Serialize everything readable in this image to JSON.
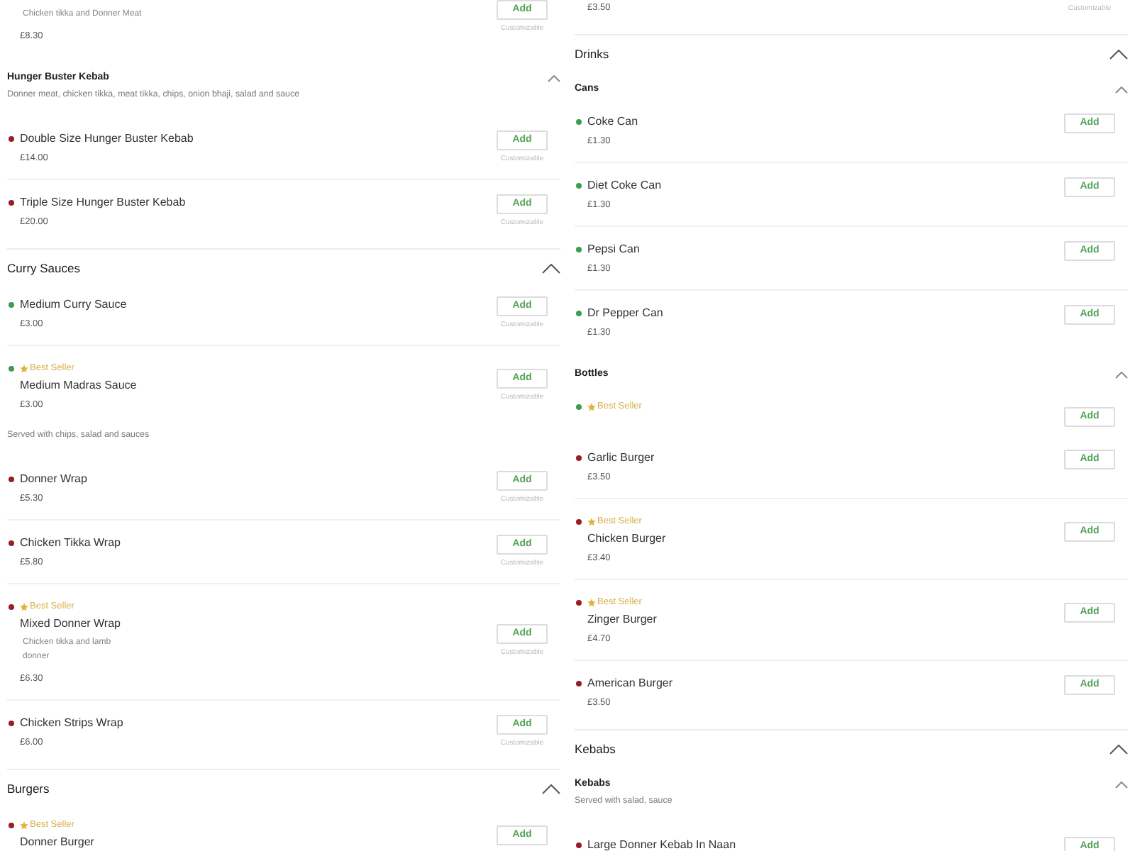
{
  "columns": [
    {
      "groups": [
        {
          "kind": "plain",
          "items": [
            {
              "description": "Chicken tikka and Donner Meat",
              "price": "£8.30",
              "button": "Add",
              "note": "Customizable"
            }
          ]
        },
        {
          "kind": "subsection",
          "title": "Hunger Buster Kebab",
          "description": "Donner meat, chicken tikka, meat tikka, chips, onion bhaji, salad and sauce",
          "expanded": true,
          "items": [
            {
              "color": "#9a1c25",
              "name": "Double Size Hunger Buster Kebab",
              "price": "£14.00",
              "button": "Add",
              "note": "Customizable"
            },
            {
              "color": "#9a1c25",
              "name": "Triple Size Hunger Buster Kebab",
              "price": "£20.00",
              "button": "Add",
              "note": "Customizable"
            }
          ]
        },
        {
          "kind": "section",
          "title": "Curry Sauces",
          "expanded": true,
          "items": [
            {
              "color": "#3e9b4f",
              "name": "Medium Curry Sauce",
              "price": "£3.00",
              "button": "Add",
              "note": "Customizable"
            },
            {
              "color": "#3e9b4f",
              "badge": "Best Seller",
              "name": "Medium Madras Sauce",
              "price": "£3.00",
              "button": "Add",
              "note": "Customizable"
            }
          ]
        },
        {
          "kind": "subsection",
          "description": "Served with chips, salad and sauces",
          "items": [
            {
              "color": "#9a1c25",
              "name": "Donner Wrap",
              "price": "£5.30",
              "button": "Add",
              "note": "Customizable"
            },
            {
              "color": "#9a1c25",
              "name": "Chicken Tikka Wrap",
              "price": "£5.80",
              "button": "Add",
              "note": "Customizable"
            },
            {
              "color": "#9a1c25",
              "badge": "Best Seller",
              "name": "Mixed Donner Wrap",
              "description": "Chicken tikka and lamb\ndonner",
              "price": "£6.30",
              "button": "Add",
              "note": "Customizable"
            },
            {
              "color": "#9a1c25",
              "name": "Chicken Strips Wrap",
              "price": "£6.00",
              "button": "Add",
              "note": "Customizable"
            }
          ]
        },
        {
          "kind": "section",
          "title": "Burgers",
          "expanded": true,
          "items": [
            {
              "color": "#9a1c25",
              "badge": "Best Seller",
              "name": "Donner Burger",
              "button": "Add"
            }
          ]
        }
      ]
    },
    {
      "groups": [
        {
          "kind": "plain",
          "items": [
            {
              "price": "£3.50",
              "note": "Customizable"
            }
          ]
        },
        {
          "kind": "section",
          "title": "Drinks",
          "expanded": true
        },
        {
          "kind": "subsection",
          "title": "Cans",
          "expanded": true,
          "items": [
            {
              "color": "#3e9b4f",
              "name": "Coke Can",
              "price": "£1.30",
              "button": "Add"
            },
            {
              "color": "#3e9b4f",
              "name": "Diet Coke Can",
              "price": "£1.30",
              "button": "Add"
            },
            {
              "color": "#3e9b4f",
              "name": "Pepsi Can",
              "price": "£1.30",
              "button": "Add"
            },
            {
              "color": "#3e9b4f",
              "name": "Dr Pepper Can",
              "price": "£1.30",
              "button": "Add"
            }
          ]
        },
        {
          "kind": "subsection",
          "title": "Bottles",
          "expanded": true,
          "items": [
            {
              "color": "#3e9b4f",
              "badge": "Best Seller",
              "button": "Add"
            }
          ]
        },
        {
          "kind": "plain",
          "items": [
            {
              "color": "#9a1c25",
              "name": "Garlic Burger",
              "price": "£3.50",
              "button": "Add"
            },
            {
              "color": "#9a1c25",
              "badge": "Best Seller",
              "name": "Chicken Burger",
              "price": "£3.40",
              "button": "Add"
            },
            {
              "color": "#9a1c25",
              "badge": "Best Seller",
              "name": "Zinger Burger",
              "price": "£4.70",
              "button": "Add"
            },
            {
              "color": "#9a1c25",
              "name": "American Burger",
              "price": "£3.50",
              "button": "Add"
            }
          ]
        },
        {
          "kind": "section",
          "title": "Kebabs",
          "expanded": true
        },
        {
          "kind": "subsection",
          "title": "Kebabs",
          "description": "Served with salad, sauce",
          "expanded": true,
          "items": [
            {
              "color": "#9a1c25",
              "name": "Large Donner Kebab In Naan",
              "button": "Add"
            }
          ]
        }
      ]
    }
  ]
}
